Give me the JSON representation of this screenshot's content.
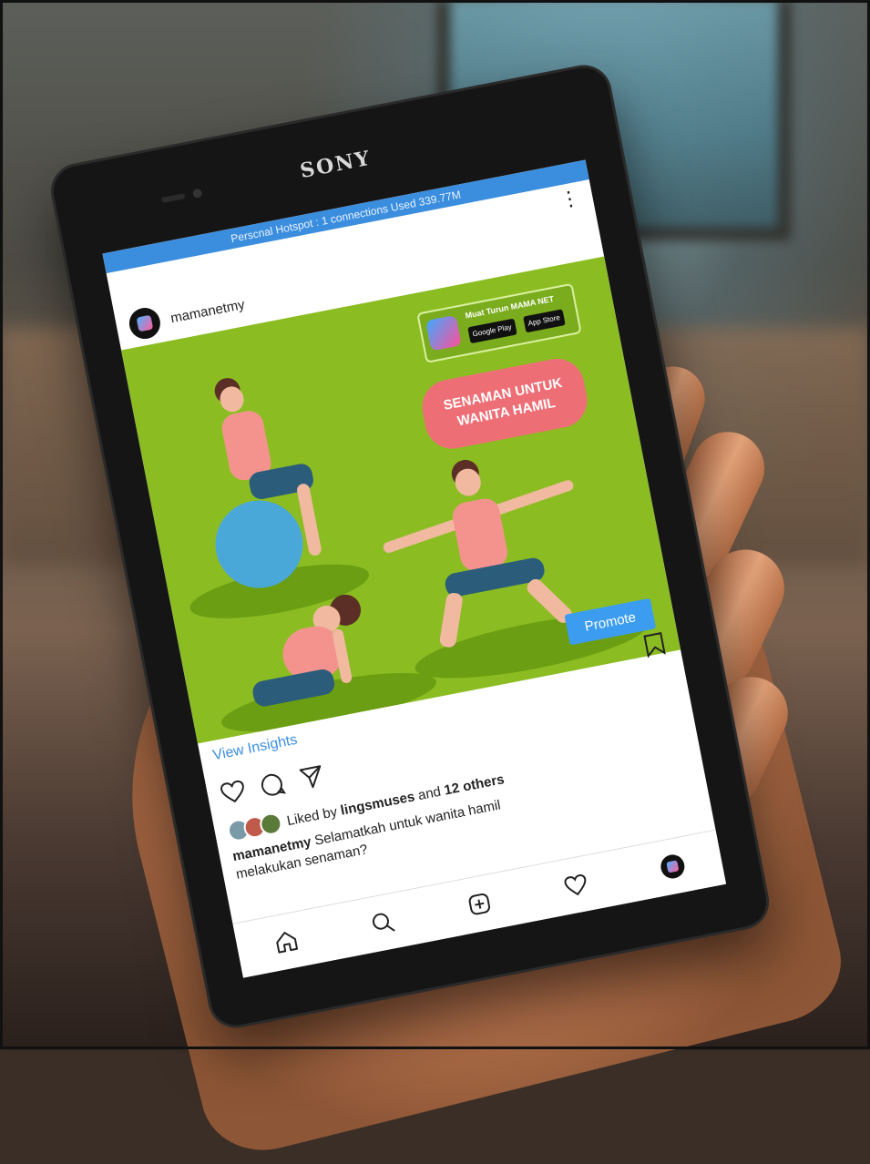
{
  "device": {
    "brand": "SONY"
  },
  "status_bar": {
    "hotspot_text": "Perscnal Hotspot : 1 connections Used 339.77M"
  },
  "post": {
    "username": "mamanetmy",
    "badge": {
      "tagline": "Muat Turun MAMA NET",
      "google_play": "Google Play",
      "app_store": "App Store"
    },
    "title_line1": "SENAMAN UNTUK",
    "title_line2": "WANITA HAMIL",
    "promote_label": "Promote",
    "insights_label": "View Insights",
    "liked_prefix": "Liked by",
    "liked_user": "lingsmuses",
    "liked_mid": "and",
    "liked_others": "12 others",
    "caption_user": "mamanetmy",
    "caption_text": "Selamatkah untuk wanita hamil melakukan senaman?"
  },
  "colors": {
    "post_background": "#8bbd22",
    "accent_blue": "#3c9df0",
    "title_pill": "#ee6e76"
  },
  "icons": [
    "more-vertical-icon",
    "heart-icon",
    "comment-icon",
    "share-icon",
    "bookmark-icon",
    "home-icon",
    "search-icon",
    "add-icon",
    "activity-icon",
    "profile-avatar"
  ]
}
